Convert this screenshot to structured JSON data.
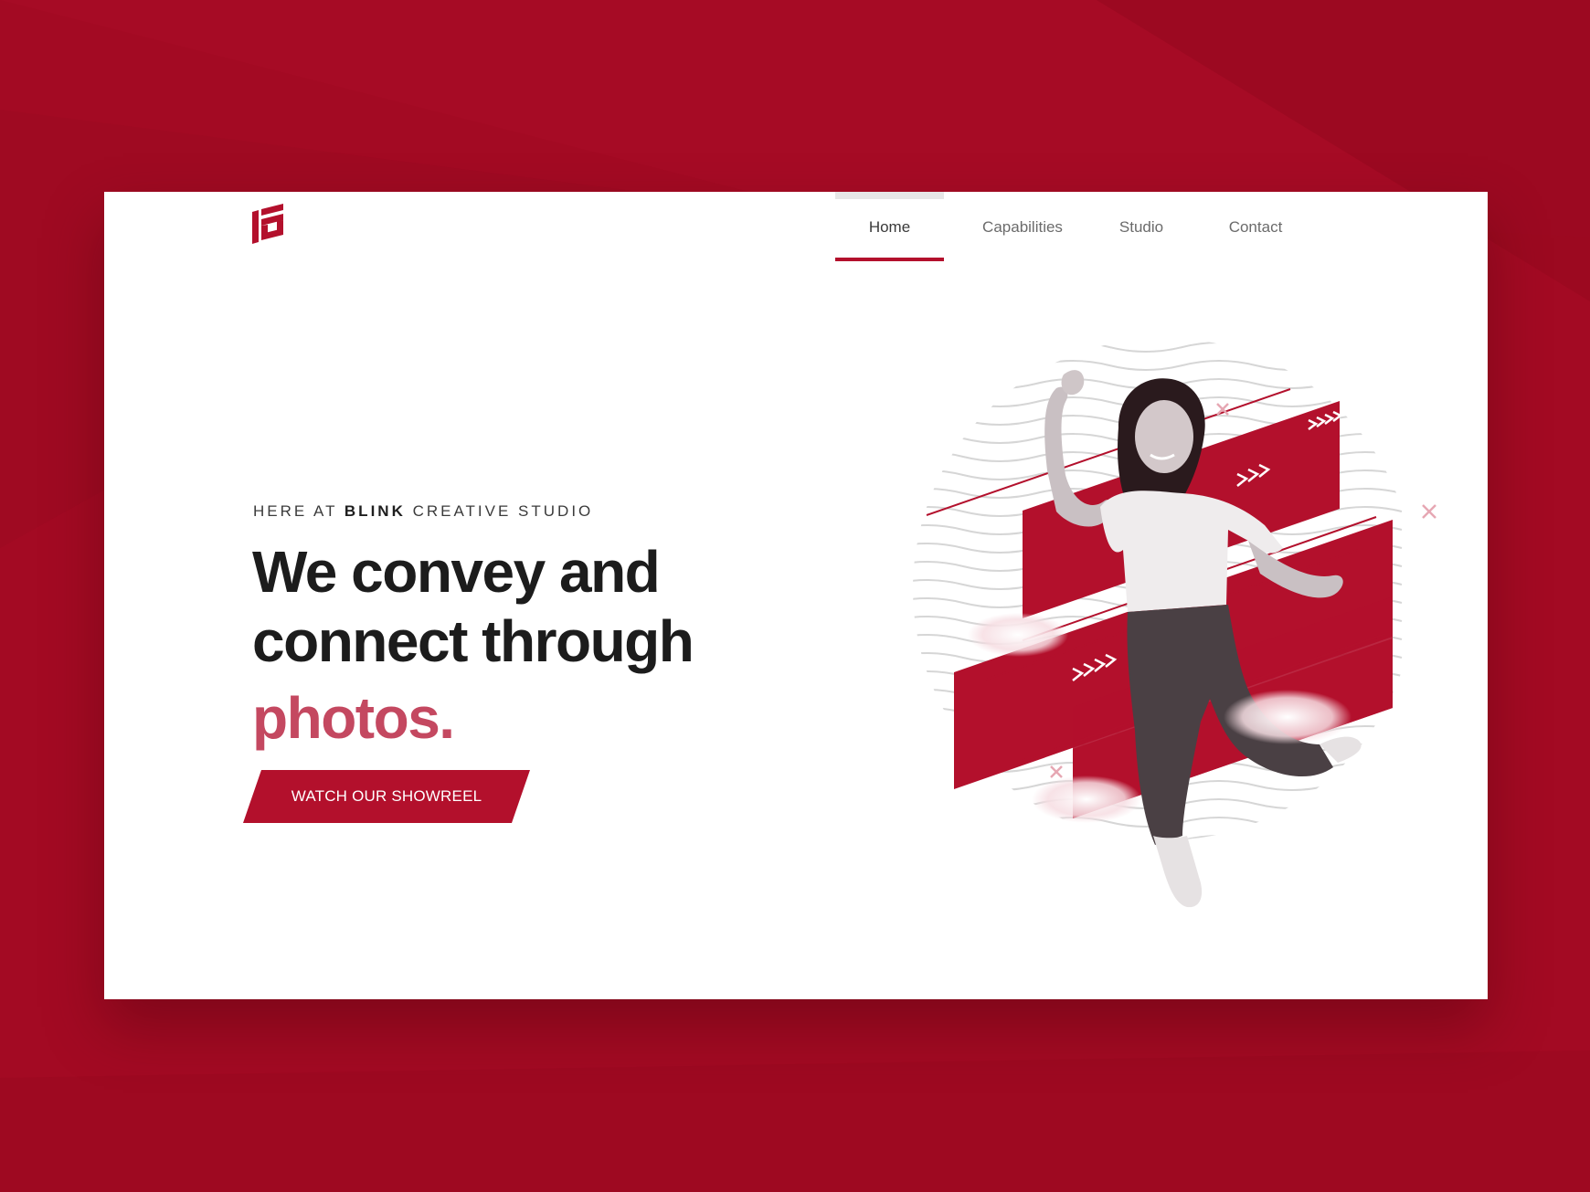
{
  "colors": {
    "background": "#a30a23",
    "accent": "#b3102c",
    "headline_accent": "#c44860",
    "text": "#1c1c1c",
    "nav_text": "#6b6b6b"
  },
  "brand": {
    "logo_icon": "stacked-stripes-logo-icon"
  },
  "nav": {
    "items": [
      {
        "label": "Home",
        "active": true
      },
      {
        "label": "Capabilities",
        "active": false
      },
      {
        "label": "Studio",
        "active": false
      },
      {
        "label": "Contact",
        "active": false
      }
    ]
  },
  "hero": {
    "eyebrow_prefix": "HERE AT ",
    "eyebrow_brand": "BLINK",
    "eyebrow_suffix": " CREATIVE STUDIO",
    "headline_line1": "We convey and",
    "headline_line2": "connect through",
    "headline_accent": "photos.",
    "cta_label": "WATCH OUR SHOWREEL"
  },
  "artwork": {
    "subject": "jumping-woman-photo",
    "decor_icons": [
      "chevron-arrows-icon",
      "close-x-icon",
      "cloud-icon"
    ]
  }
}
